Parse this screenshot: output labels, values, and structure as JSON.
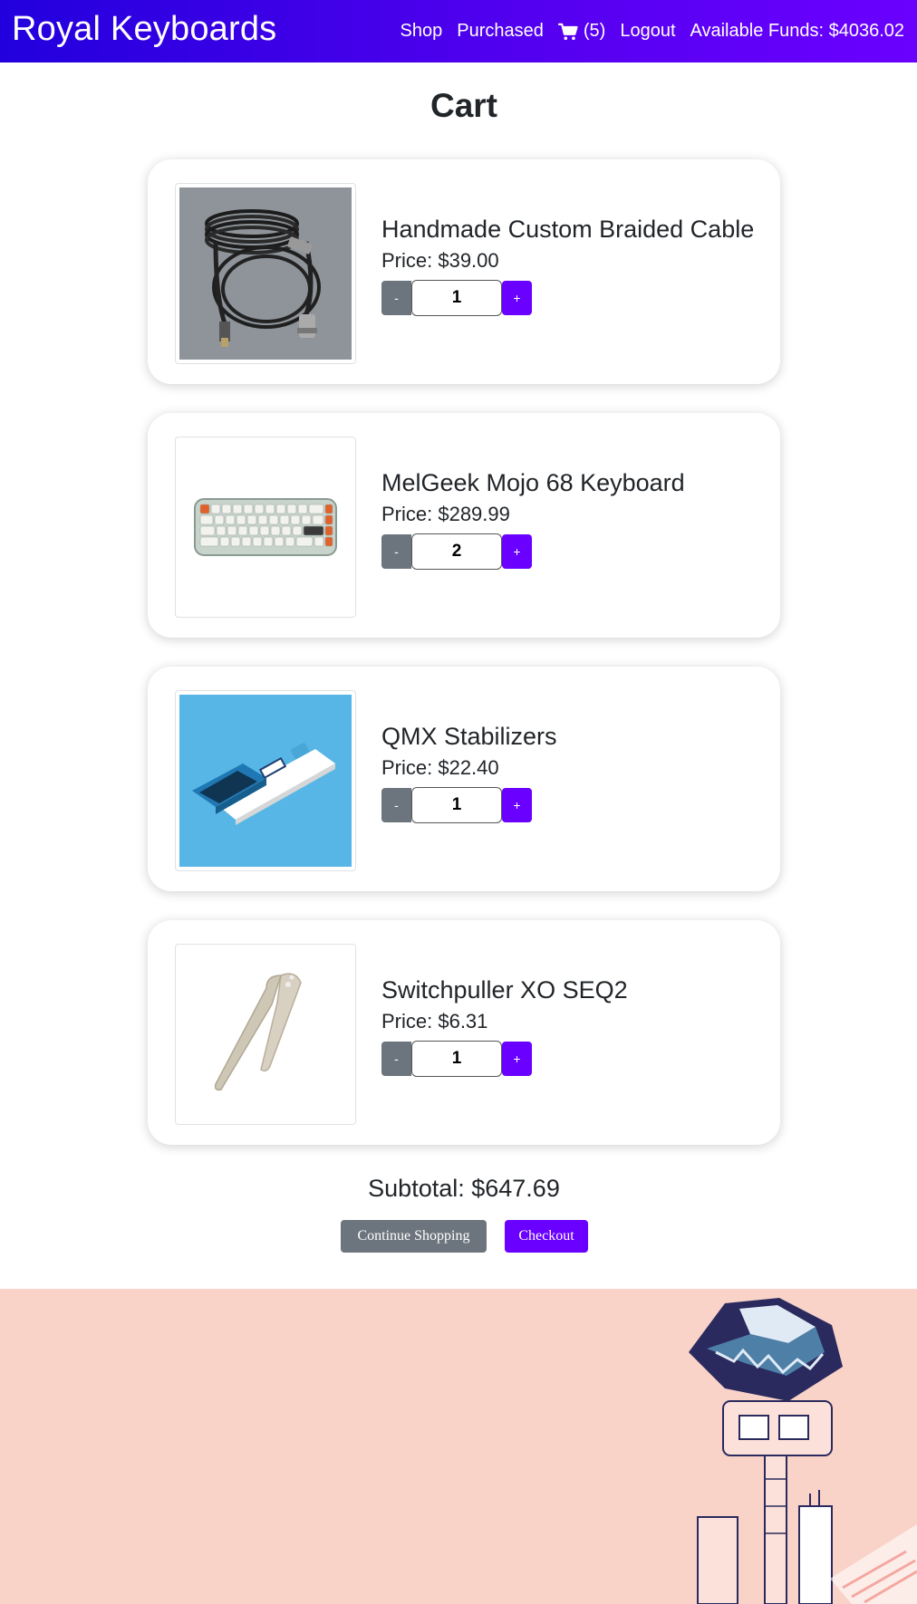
{
  "app": {
    "brand": "Royal Keyboards"
  },
  "nav": {
    "shop": "Shop",
    "purchased": "Purchased",
    "cart_count": "(5)",
    "logout": "Logout",
    "funds": "Available Funds: $4036.02"
  },
  "page": {
    "title": "Cart"
  },
  "cart": {
    "items": [
      {
        "name": "Handmade Custom Braided Cable",
        "price": "Price: $39.00",
        "qty": "1",
        "image": "coiled-cable"
      },
      {
        "name": "MelGeek Mojo 68 Keyboard",
        "price": "Price: $289.99",
        "qty": "2",
        "image": "keyboard"
      },
      {
        "name": "QMX Stabilizers",
        "price": "Price: $22.40",
        "qty": "1",
        "image": "stabilizer-box"
      },
      {
        "name": "Switchpuller XO SEQ2",
        "price": "Price: $6.31",
        "qty": "1",
        "image": "switch-puller"
      }
    ],
    "minus_label": "-",
    "plus_label": "+",
    "subtotal": "Subtotal: $647.69",
    "continue_label": "Continue Shopping",
    "checkout_label": "Checkout"
  },
  "colors": {
    "nav_start": "#2200dd",
    "nav_end": "#6a00ff",
    "primary": "#6a00ff",
    "secondary": "#6c757d",
    "footer_bg": "#fad3c8"
  }
}
